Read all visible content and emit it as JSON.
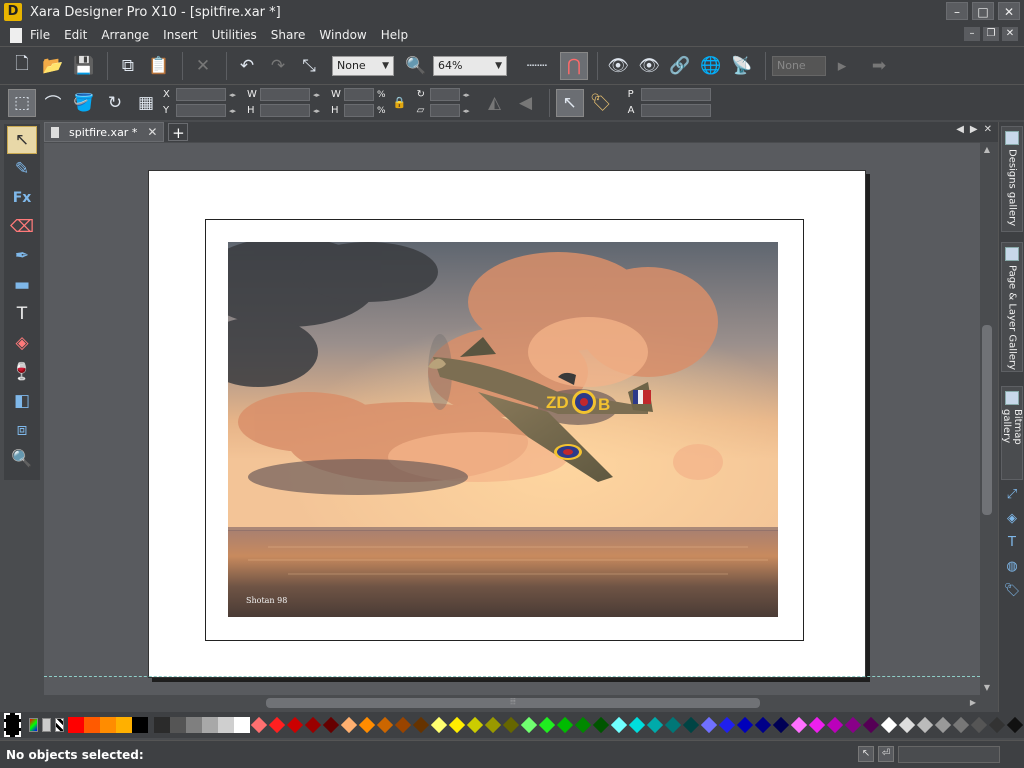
{
  "window": {
    "title": "Xara Designer Pro X10 - [spitfire.xar *]",
    "logo": "D",
    "controls": [
      "–",
      "□",
      "✕"
    ],
    "mdi_controls": [
      "–",
      "❐",
      "✕"
    ]
  },
  "menu": [
    "File",
    "Edit",
    "Arrange",
    "Insert",
    "Utilities",
    "Share",
    "Window",
    "Help"
  ],
  "toolbar": {
    "feather_value": "None",
    "zoom_value": "64%",
    "brush_value": "None"
  },
  "infobar": {
    "x_label": "X",
    "y_label": "Y",
    "w_label": "W",
    "h_label": "H",
    "sw_label": "W",
    "sh_label": "H",
    "pct": "%",
    "p_label": "P",
    "a_label": "A"
  },
  "document_tab": {
    "name": "spitfire.xar *",
    "close": "✕",
    "add": "+"
  },
  "artwork": {
    "signature": "Shotan 98",
    "plane_code": "ZD",
    "plane_letter": "B"
  },
  "galleries": [
    "Designs gallery",
    "Page & Layer Gallery",
    "Bitmap gallery"
  ],
  "status": {
    "message": "No objects selected:"
  },
  "palette_colors": [
    "#ff0000",
    "#ff5a00",
    "#ff8c00",
    "#ffb000",
    "#000000",
    "#2b2b2b",
    "#555555",
    "#7f7f7f",
    "#a8a8a8",
    "#cfcfcf",
    "#ffffff"
  ],
  "palette_diamonds": [
    "#ff7070",
    "#ff2020",
    "#cc0000",
    "#990000",
    "#660000",
    "#ffb070",
    "#ff8c00",
    "#cc6600",
    "#994400",
    "#663300",
    "#ffff70",
    "#ffee00",
    "#cccc00",
    "#999900",
    "#666600",
    "#70ff70",
    "#20ee20",
    "#00bb00",
    "#008800",
    "#005500",
    "#70ffff",
    "#00dddd",
    "#00aaaa",
    "#007777",
    "#004444",
    "#7070ff",
    "#2020ee",
    "#0000bb",
    "#000088",
    "#000055",
    "#ff70ff",
    "#ee20ee",
    "#bb00bb",
    "#880088",
    "#550055",
    "#ffffff",
    "#dddddd",
    "#bbbbbb",
    "#999999",
    "#777777",
    "#555555",
    "#333333",
    "#111111"
  ]
}
